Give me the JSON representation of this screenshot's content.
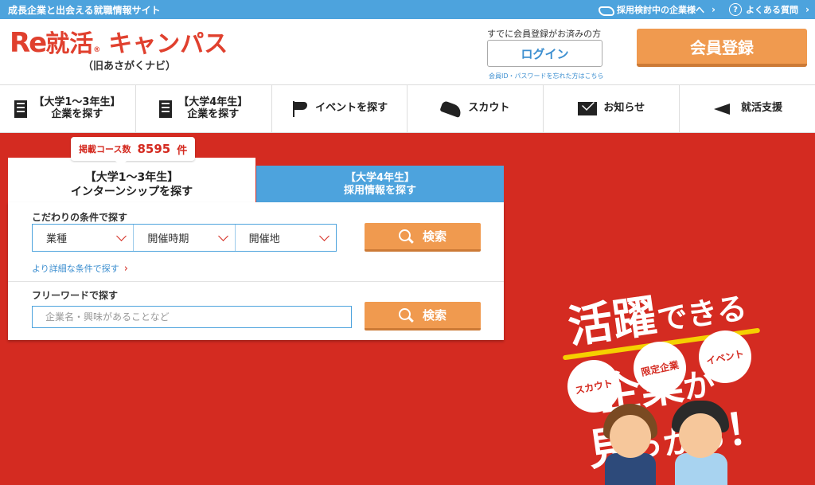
{
  "topbar": {
    "tagline": "成長企業と出会える就職情報サイト",
    "link_companies": "採用検討中の企業様へ",
    "link_faq": "よくある質問"
  },
  "header": {
    "logo_re": "Re",
    "logo_shu": "就活",
    "logo_reg": "®",
    "logo_campus": "キャンパス",
    "logo_sub": "（旧あさがくナビ）",
    "already_member": "すでに会員登録がお済みの方",
    "login_label": "ログイン",
    "forgot_text": "会員ID・パスワードを忘れた方はこちら",
    "register_label": "会員登録"
  },
  "nav": {
    "items": [
      {
        "line1": "【大学1〜3年生】",
        "line2": "企業を探す",
        "icon": "building-icon"
      },
      {
        "line1": "【大学4年生】",
        "line2": "企業を探す",
        "icon": "building-icon"
      },
      {
        "line1": "イベントを探す",
        "line2": "",
        "icon": "flag-icon"
      },
      {
        "line1": "スカウト",
        "line2": "",
        "icon": "shoe-icon"
      },
      {
        "line1": "お知らせ",
        "line2": "",
        "icon": "mail-icon"
      },
      {
        "line1": "就活支援",
        "line2": "",
        "icon": "megaphone-icon"
      }
    ]
  },
  "search": {
    "badge_label": "掲載コース数",
    "badge_count": "8595",
    "badge_unit": "件",
    "tab_active_line1": "【大学1〜3年生】",
    "tab_active_line2": "インターンシップを探す",
    "tab_inactive_line1": "【大学4年生】",
    "tab_inactive_line2": "採用情報を探す",
    "conditions_label": "こだわりの条件で探す",
    "selects": [
      "業種",
      "開催時期",
      "開催地"
    ],
    "search_label": "検索",
    "more_conditions": "より詳細な条件で探す",
    "freeword_label": "フリーワードで探す",
    "freeword_placeholder": "企業名・興味があることなど",
    "freeword_value": ""
  },
  "hero": {
    "catch_line1_big": "活躍",
    "catch_line1_small": "できる",
    "catch_line2_big": "企業",
    "catch_line2_small": "が",
    "catch_line3_big": "見",
    "catch_line3_small": "っかる",
    "catch_line3_end": "！",
    "bubbles": [
      "スカウト",
      "限定企業",
      "イベント"
    ]
  },
  "colors": {
    "accent_red": "#d42b21",
    "topbar_blue": "#4da3dd",
    "button_orange": "#f09a4f",
    "underline_yellow": "#f5d000"
  }
}
